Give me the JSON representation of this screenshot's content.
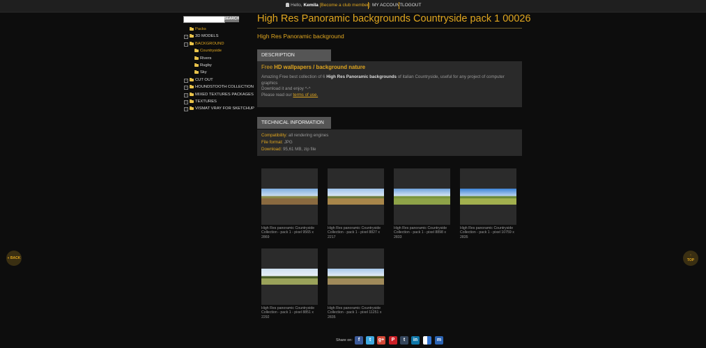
{
  "topbar": {
    "hello": "Hello,",
    "user": "Kemila",
    "club": "[Become a club member]",
    "my_account": "MY ACCOUNT",
    "logout": "LOGOUT"
  },
  "search": {
    "placeholder": "",
    "button": "SEARCH"
  },
  "tree": [
    {
      "label": "Packs",
      "sel": true
    },
    {
      "label": "3D MODELS"
    },
    {
      "label": "BACKGROUND",
      "sel": true
    },
    {
      "label": "Countryside",
      "sel": true
    },
    {
      "label": "Rivers"
    },
    {
      "label": "Rugby"
    },
    {
      "label": "Sky"
    },
    {
      "label": "CUT OUT"
    },
    {
      "label": "HOUNDSTOOTH COLLECTION"
    },
    {
      "label": "MIXED TEXTURES PACKAGES"
    },
    {
      "label": "TEXTURES"
    },
    {
      "label": "VISMAT VRAY FOR SKETCHUP"
    }
  ],
  "page": {
    "title": "High Res Panoramic backgrounds Countryside pack 1 00026",
    "subtitle": "High Res Panoramic background"
  },
  "description": {
    "title": "DESCRIPTION",
    "head_free": "Free",
    "head_bold": "HD wallpapers / background nature",
    "p1_a": "Amazing Free best collection of 6",
    "p1_b": "High Res Panoramic backgrounds",
    "p1_c": "of italian Countryside, useful for any project of computer graphics",
    "p2": "Download it and enjoy ^-^",
    "p3_a": "Please read our",
    "p3_link": "terms of use."
  },
  "technical": {
    "title": "TECHNICAL INFORMATION",
    "compat_k": "Compatibility:",
    "compat_v": "all rendering engines",
    "format_k": "File format:",
    "format_v": "JPG",
    "download_k": "Download:",
    "download_v": "95,61 MB, zip file"
  },
  "thumbs": [
    "High Res panoramic Countryside Collection - pack 1 - pixel 9565 x 2869",
    "High Res panoramic Countryside Collection - pack 1 - pixel 8827 x 2217",
    "High Res panoramic Countryside Collection - pack 1 - pixel 8898 x 2833",
    "High Res panoramic Countryside Collection - pack 1 - pixel 10759 x 2835",
    "High Res panoramic Countryside Collection - pack 1 - pixel 8851 x 2292",
    "High Res panoramic Countryside Collection - pack 1 - pixel 11251 x 2835"
  ],
  "nav": {
    "back": "BACK",
    "top": "TOP"
  },
  "share": {
    "label": "Share on:",
    "icons": [
      "facebook-icon",
      "twitter-icon",
      "googleplus-icon",
      "pinterest-icon",
      "tumblr-icon",
      "linkedin-icon",
      "delicious-icon",
      "myspace-icon"
    ]
  },
  "colors": {
    "accent": "#e0a61f",
    "panel": "#2a2a2a",
    "background": "#0d0d0d"
  }
}
